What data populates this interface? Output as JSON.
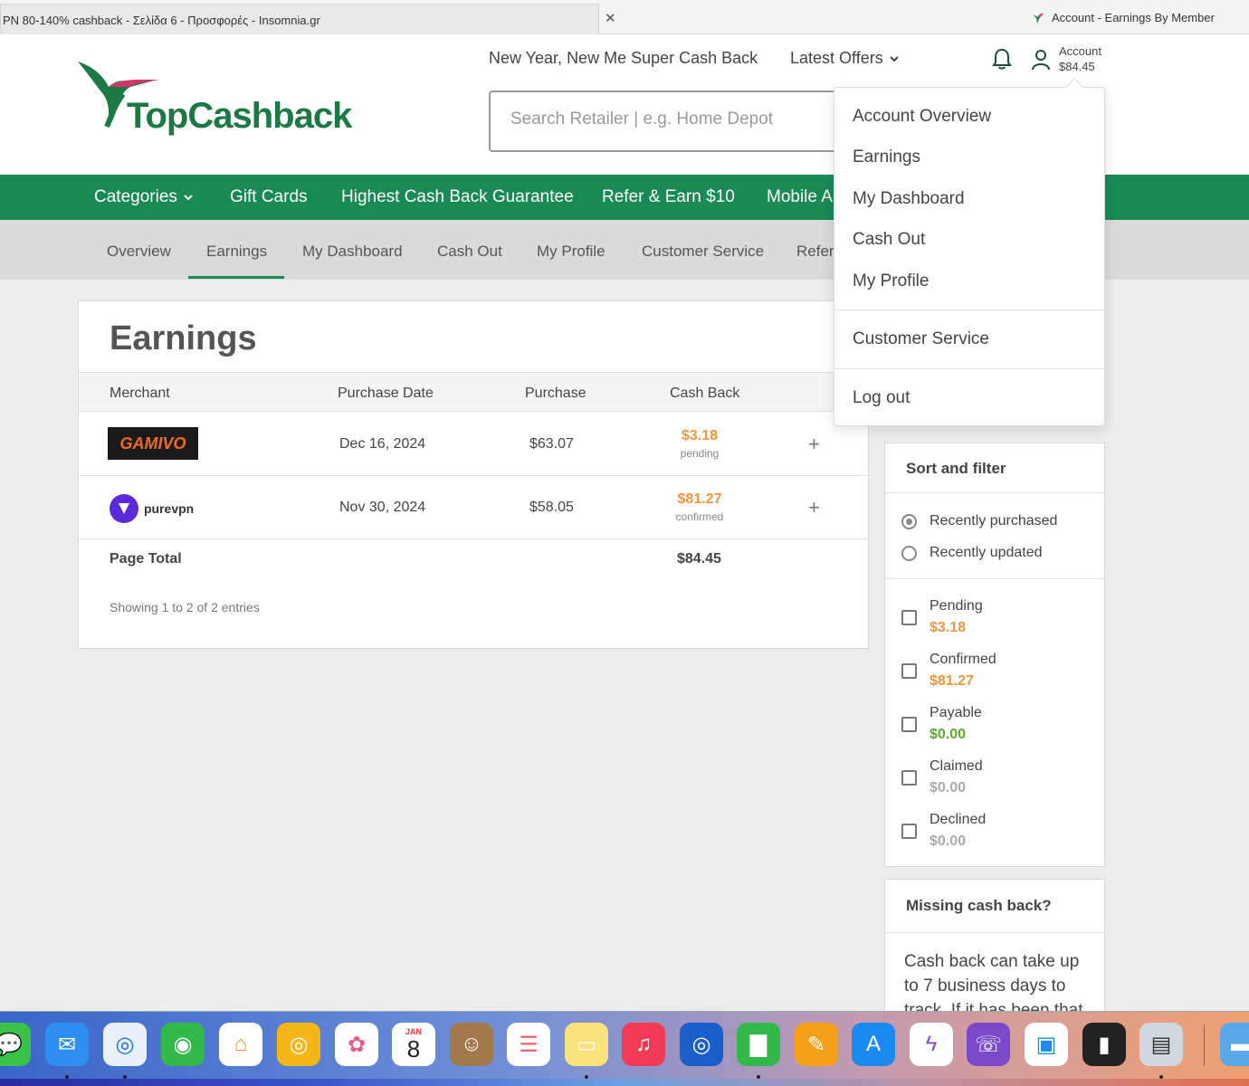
{
  "browser": {
    "active_tab": "PN 80-140% cashback - Σελίδα 6 - Προσφορές - Insomnia.gr",
    "other_tab": "Account - Earnings By Member"
  },
  "header": {
    "logo_text": "TopCashback",
    "promo_link": "New Year, New Me Super Cash Back",
    "latest_offers": "Latest Offers",
    "account_label": "Account",
    "account_balance": "$84.45",
    "search_placeholder": "Search Retailer | e.g. Home Depot"
  },
  "green_nav": {
    "categories": "Categories",
    "gift_cards": "Gift Cards",
    "guarantee": "Highest Cash Back Guarantee",
    "refer": "Refer & Earn $10",
    "mobile": "Mobile A"
  },
  "sub_nav": {
    "overview": "Overview",
    "earnings": "Earnings",
    "dashboard": "My Dashboard",
    "cash_out": "Cash Out",
    "profile": "My Profile",
    "customer_service": "Customer Service",
    "refer": "Refer"
  },
  "earnings": {
    "title": "Earnings",
    "columns": {
      "merchant": "Merchant",
      "purchase_date": "Purchase Date",
      "purchase": "Purchase",
      "cash_back": "Cash Back"
    },
    "rows": [
      {
        "merchant": "GAMIVO",
        "date": "Dec 16, 2024",
        "purchase": "$63.07",
        "cash_back": "$3.18",
        "status": "pending"
      },
      {
        "merchant": "purevpn",
        "date": "Nov 30, 2024",
        "purchase": "$58.05",
        "cash_back": "$81.27",
        "status": "confirmed"
      }
    ],
    "page_total_label": "Page Total",
    "page_total_value": "$84.45",
    "showing": "Showing 1 to 2 of 2 entries"
  },
  "sort_filter": {
    "title": "Sort and filter",
    "recently_purchased": "Recently purchased",
    "recently_updated": "Recently updated",
    "filters": [
      {
        "label": "Pending",
        "value": "$3.18",
        "color": "#f7943a"
      },
      {
        "label": "Confirmed",
        "value": "$81.27",
        "color": "#f7943a"
      },
      {
        "label": "Payable",
        "value": "$0.00",
        "color": "#5aaa2a"
      },
      {
        "label": "Claimed",
        "value": "$0.00",
        "color": "#aaaaaa"
      },
      {
        "label": "Declined",
        "value": "$0.00",
        "color": "#aaaaaa"
      }
    ]
  },
  "missing": {
    "title": "Missing cash back?",
    "text": "Cash back can take up to 7 business days to track. If it has been that"
  },
  "account_menu": {
    "overview": "Account Overview",
    "earnings": "Earnings",
    "dashboard": "My Dashboard",
    "cash_out": "Cash Out",
    "profile": "My Profile",
    "customer_service": "Customer Service",
    "logout": "Log out"
  },
  "dock": {
    "calendar_month": "JAN",
    "calendar_day": "8"
  },
  "colors": {
    "brand_green": "#1a8a55",
    "pending_orange": "#f7943a"
  }
}
